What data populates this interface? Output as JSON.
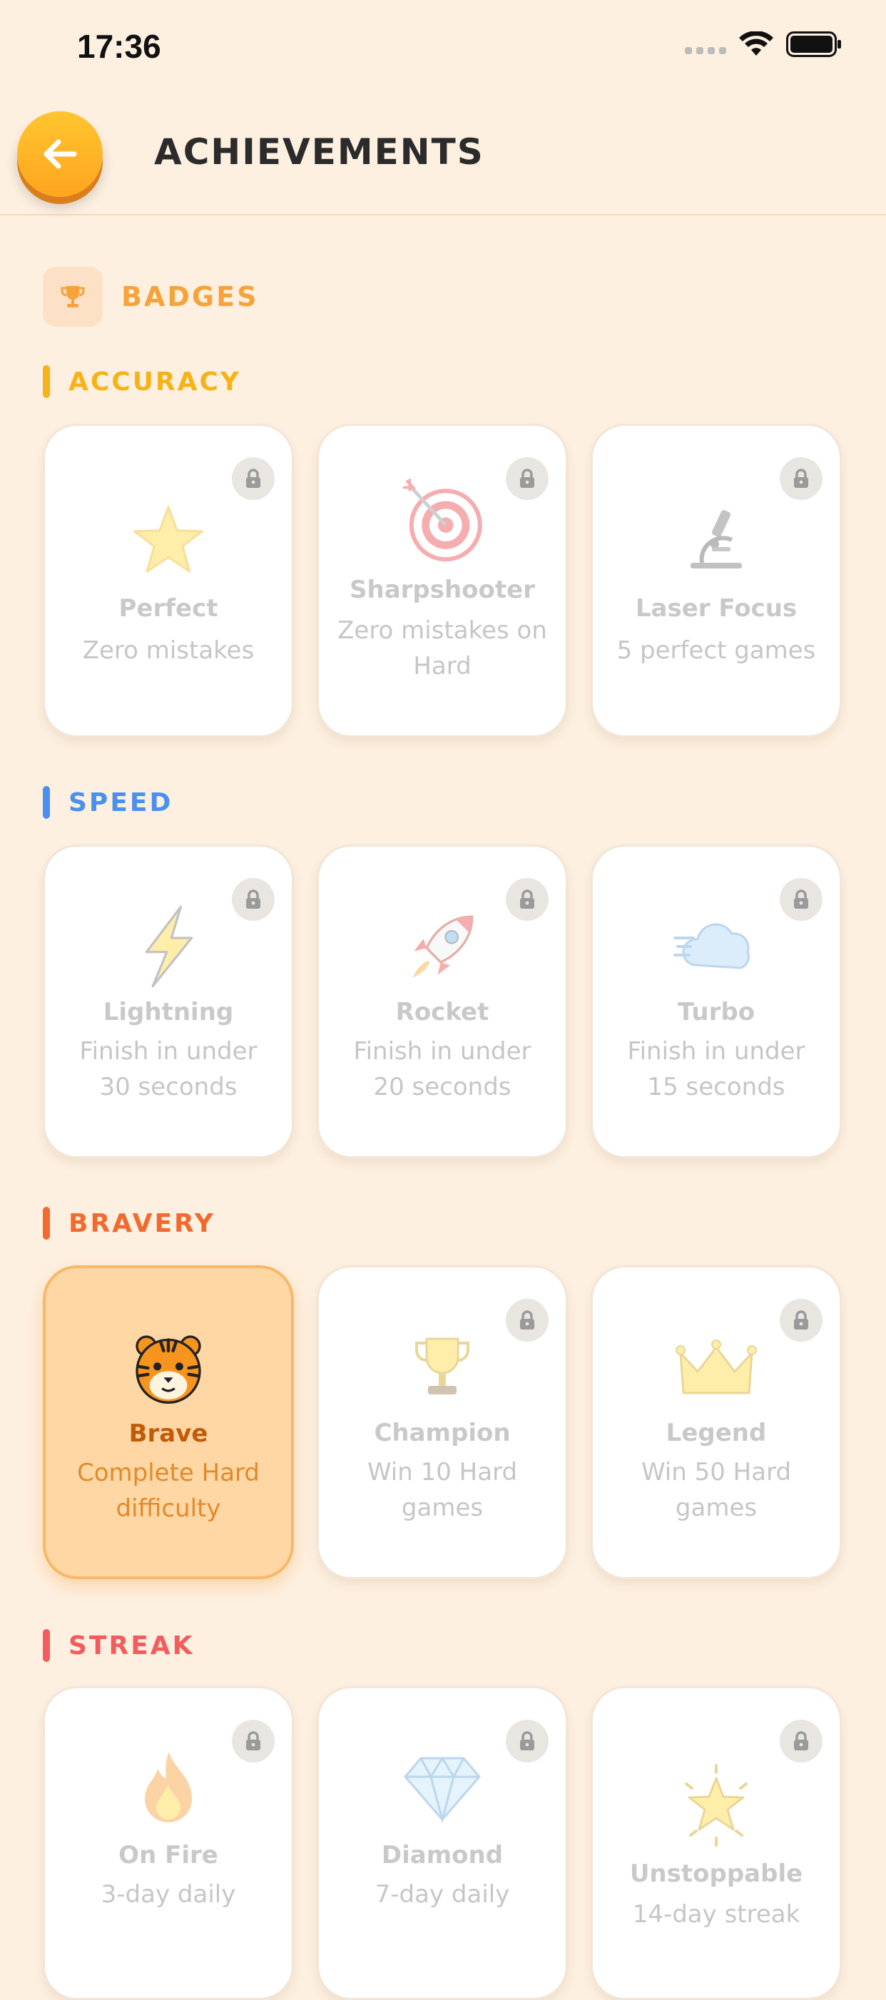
{
  "status_bar": {
    "time": "17:36"
  },
  "header": {
    "title": "ACHIEVEMENTS"
  },
  "badges_section": {
    "title": "BADGES"
  },
  "colors": {
    "background": "#FDF0E1",
    "accent_orange": "#FFA51E",
    "accuracy": "#F6B318",
    "speed": "#4A90F0",
    "bravery": "#F26A2E",
    "streak": "#F25C5C",
    "earned_card": "#FFD7A4"
  },
  "categories": [
    {
      "label": "ACCURACY",
      "color": "#F6B318",
      "badges": [
        {
          "name": "Perfect",
          "desc": "Zero mistakes",
          "icon": "star-icon",
          "locked": true
        },
        {
          "name": "Sharpshooter",
          "desc": "Zero mistakes on Hard",
          "icon": "target-icon",
          "locked": true
        },
        {
          "name": "Laser Focus",
          "desc": "5 perfect games",
          "icon": "microscope-icon",
          "locked": true
        }
      ]
    },
    {
      "label": "SPEED",
      "color": "#4A90F0",
      "badges": [
        {
          "name": "Lightning",
          "desc": "Finish in under 30 seconds",
          "icon": "lightning-icon",
          "locked": true
        },
        {
          "name": "Rocket",
          "desc": "Finish in under 20 seconds",
          "icon": "rocket-icon",
          "locked": true
        },
        {
          "name": "Turbo",
          "desc": "Finish in under 15 seconds",
          "icon": "wind-cloud-icon",
          "locked": true
        }
      ]
    },
    {
      "label": "BRAVERY",
      "color": "#F26A2E",
      "badges": [
        {
          "name": "Brave",
          "desc": "Complete Hard difficulty",
          "icon": "tiger-icon",
          "locked": false
        },
        {
          "name": "Champion",
          "desc": "Win 10 Hard games",
          "icon": "trophy-icon",
          "locked": true
        },
        {
          "name": "Legend",
          "desc": "Win 50 Hard games",
          "icon": "crown-icon",
          "locked": true
        }
      ]
    },
    {
      "label": "STREAK",
      "color": "#F25C5C",
      "badges": [
        {
          "name": "On Fire",
          "desc": "3-day daily",
          "icon": "fire-icon",
          "locked": true
        },
        {
          "name": "Diamond",
          "desc": "7-day daily",
          "icon": "diamond-icon",
          "locked": true
        },
        {
          "name": "Unstoppable",
          "desc": "14-day streak",
          "icon": "glowing-star-icon",
          "locked": true
        }
      ]
    }
  ]
}
